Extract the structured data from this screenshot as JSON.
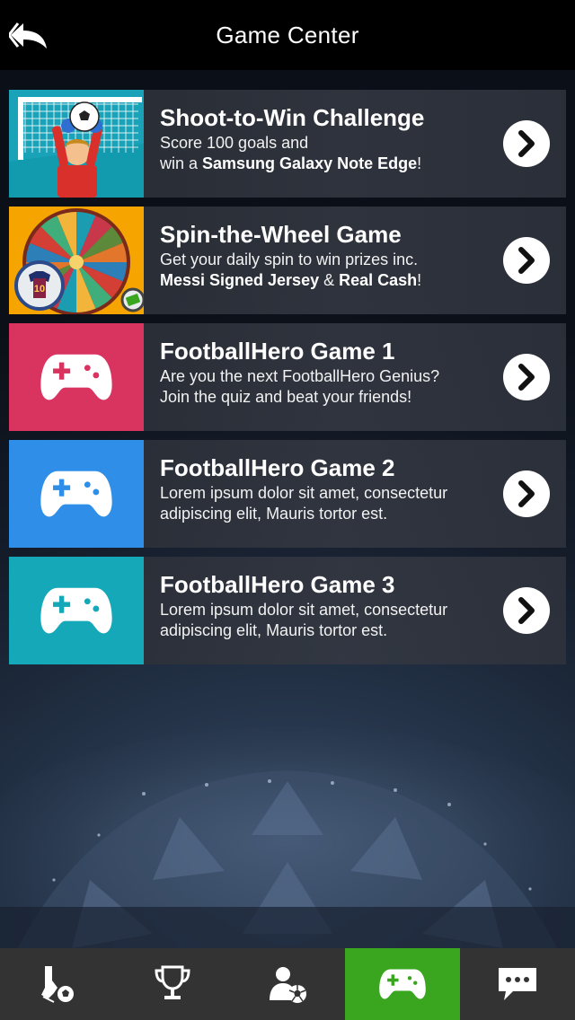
{
  "header": {
    "title": "Game Center",
    "back_icon": "back-arrow-icon"
  },
  "games": [
    {
      "title": "Shoot-to-Win Challenge",
      "line1": [
        {
          "text": "Score 100 goals and",
          "bold": false
        }
      ],
      "line2": [
        {
          "text": "win a ",
          "bold": false
        },
        {
          "text": "Samsung Galaxy Note Edge",
          "bold": true
        },
        {
          "text": "!",
          "bold": false
        }
      ],
      "thumb": "goalkeeper-image",
      "thumb_color": "#1aa3b8"
    },
    {
      "title": "Spin-the-Wheel Game",
      "line1": [
        {
          "text": "Get your daily spin to win prizes inc.",
          "bold": false
        }
      ],
      "line2": [
        {
          "text": "Messi Signed Jersey",
          "bold": true
        },
        {
          "text": " & ",
          "bold": false
        },
        {
          "text": "Real Cash",
          "bold": true
        },
        {
          "text": "!",
          "bold": false
        }
      ],
      "thumb": "prize-wheel-image",
      "thumb_color": "#f5a400",
      "jersey_number": "10"
    },
    {
      "title": "FootballHero Game 1",
      "line1": [
        {
          "text": "Are you the next FootballHero Genius?",
          "bold": false
        }
      ],
      "line2": [
        {
          "text": "Join the quiz and beat your friends!",
          "bold": false
        }
      ],
      "thumb": "gamepad-icon",
      "thumb_color": "#d93360"
    },
    {
      "title": "FootballHero Game 2",
      "line1": [
        {
          "text": "Lorem ipsum dolor sit amet, consectetur",
          "bold": false
        }
      ],
      "line2": [
        {
          "text": "adipiscing elit, Mauris tortor est.",
          "bold": false
        }
      ],
      "thumb": "gamepad-icon",
      "thumb_color": "#2f8fe8"
    },
    {
      "title": "FootballHero Game 3",
      "line1": [
        {
          "text": "Lorem ipsum dolor sit amet, consectetur",
          "bold": false
        }
      ],
      "line2": [
        {
          "text": "adipiscing elit, Mauris tortor est.",
          "bold": false
        }
      ],
      "thumb": "gamepad-icon",
      "thumb_color": "#14a8b8"
    }
  ],
  "tabs": [
    {
      "icon": "boot-ball-icon",
      "active": false
    },
    {
      "icon": "trophy-icon",
      "active": false
    },
    {
      "icon": "user-ball-icon",
      "active": false
    },
    {
      "icon": "gamepad-icon",
      "active": true
    },
    {
      "icon": "chat-icon",
      "active": false
    }
  ],
  "colors": {
    "active_tab": "#3aa61f",
    "tabbar": "#333333",
    "header": "#000000"
  }
}
